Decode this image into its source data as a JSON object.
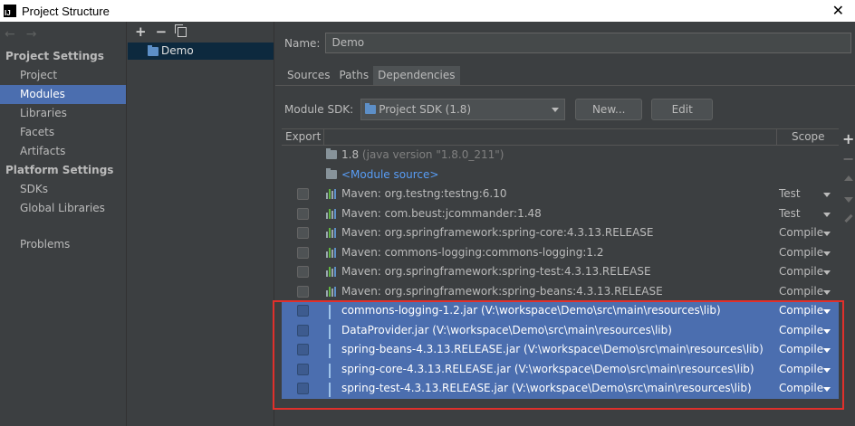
{
  "window": {
    "title": "Project Structure",
    "close_label": "✕"
  },
  "nav": {
    "back_icon": "arrow-left-icon",
    "forward_icon": "arrow-right-icon",
    "back": "←",
    "forward": "→"
  },
  "sidebar": {
    "project_settings_title": "Project Settings",
    "project_items": [
      {
        "label": "Project",
        "selected": false
      },
      {
        "label": "Modules",
        "selected": true
      },
      {
        "label": "Libraries",
        "selected": false
      },
      {
        "label": "Facets",
        "selected": false
      },
      {
        "label": "Artifacts",
        "selected": false
      }
    ],
    "platform_settings_title": "Platform Settings",
    "platform_items": [
      {
        "label": "SDKs"
      },
      {
        "label": "Global Libraries"
      }
    ],
    "problems_label": "Problems"
  },
  "modules": {
    "toolbar": {
      "add": "+",
      "remove": "−"
    },
    "items": [
      {
        "label": "Demo",
        "selected": true
      }
    ]
  },
  "main": {
    "name_label": "Name:",
    "name_value": "Demo",
    "tabs": [
      {
        "label": "Sources",
        "active": false
      },
      {
        "label": "Paths",
        "active": false
      },
      {
        "label": "Dependencies",
        "active": true
      }
    ],
    "module_sdk_label": "Module SDK:",
    "module_sdk_value": "Project SDK (1.8)",
    "new_button": "New...",
    "edit_button": "Edit"
  },
  "dependencies": {
    "headers": {
      "export": "Export",
      "scope": "Scope"
    },
    "sdk_row": {
      "name": "1.8",
      "detail": "(java version \"1.8.0_211\")"
    },
    "module_source": "<Module source>",
    "rows": [
      {
        "name": "Maven: org.testng:testng:6.10",
        "scope": "Test",
        "icon": "maven-library-icon",
        "selected": false
      },
      {
        "name": "Maven: com.beust:jcommander:1.48",
        "scope": "Test",
        "icon": "maven-library-icon",
        "selected": false
      },
      {
        "name": "Maven: org.springframework:spring-core:4.3.13.RELEASE",
        "scope": "Compile",
        "icon": "maven-library-icon",
        "selected": false
      },
      {
        "name": "Maven: commons-logging:commons-logging:1.2",
        "scope": "Compile",
        "icon": "maven-library-icon",
        "selected": false
      },
      {
        "name": "Maven: org.springframework:spring-test:4.3.13.RELEASE",
        "scope": "Compile",
        "icon": "maven-library-icon",
        "selected": false
      },
      {
        "name": "Maven: org.springframework:spring-beans:4.3.13.RELEASE",
        "scope": "Compile",
        "icon": "maven-library-icon",
        "selected": false
      },
      {
        "name": "commons-logging-1.2.jar (V:\\workspace\\Demo\\src\\main\\resources\\lib)",
        "scope": "Compile",
        "icon": "jar-icon",
        "selected": true
      },
      {
        "name": "DataProvider.jar (V:\\workspace\\Demo\\src\\main\\resources\\lib)",
        "scope": "Compile",
        "icon": "jar-icon",
        "selected": true
      },
      {
        "name": "spring-beans-4.3.13.RELEASE.jar (V:\\workspace\\Demo\\src\\main\\resources\\lib)",
        "scope": "Compile",
        "icon": "jar-icon",
        "selected": true
      },
      {
        "name": "spring-core-4.3.13.RELEASE.jar (V:\\workspace\\Demo\\src\\main\\resources\\lib)",
        "scope": "Compile",
        "icon": "jar-icon",
        "selected": true
      },
      {
        "name": "spring-test-4.3.13.RELEASE.jar (V:\\workspace\\Demo\\src\\main\\resources\\lib)",
        "scope": "Compile",
        "icon": "jar-icon",
        "selected": true
      }
    ]
  },
  "right_toolbar": {
    "add": "+",
    "remove": "−"
  },
  "colors": {
    "background": "#3c3f41",
    "selection": "#4b6eaf",
    "link": "#589df6",
    "annotation_box": "#e0302b"
  }
}
